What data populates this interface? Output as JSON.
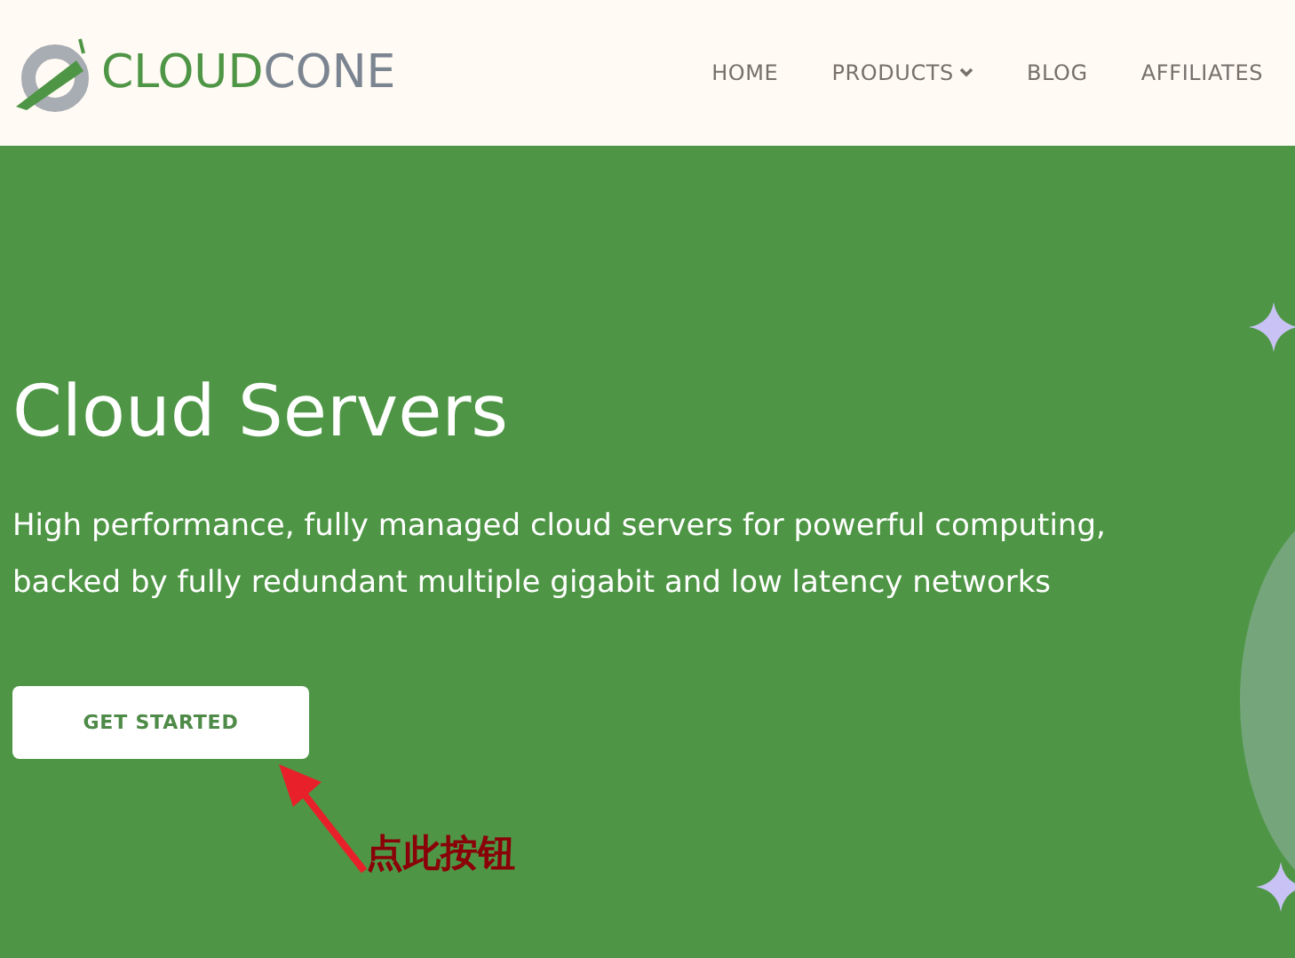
{
  "header": {
    "logo": {
      "part_1": "CLOUD",
      "part_2": "CONE"
    },
    "nav": [
      {
        "label": "HOME",
        "dropdown": false
      },
      {
        "label": "PRODUCTS",
        "dropdown": true
      },
      {
        "label": "BLOG",
        "dropdown": false
      },
      {
        "label": "AFFILIATES",
        "dropdown": false
      }
    ]
  },
  "hero": {
    "title": "Cloud Servers",
    "subtitle": "High performance, fully managed cloud servers for powerful computing, backed by fully redundant multiple gigabit and low latency networks",
    "button": "GET STARTED"
  },
  "annotation": {
    "text": "点此按钮"
  }
}
